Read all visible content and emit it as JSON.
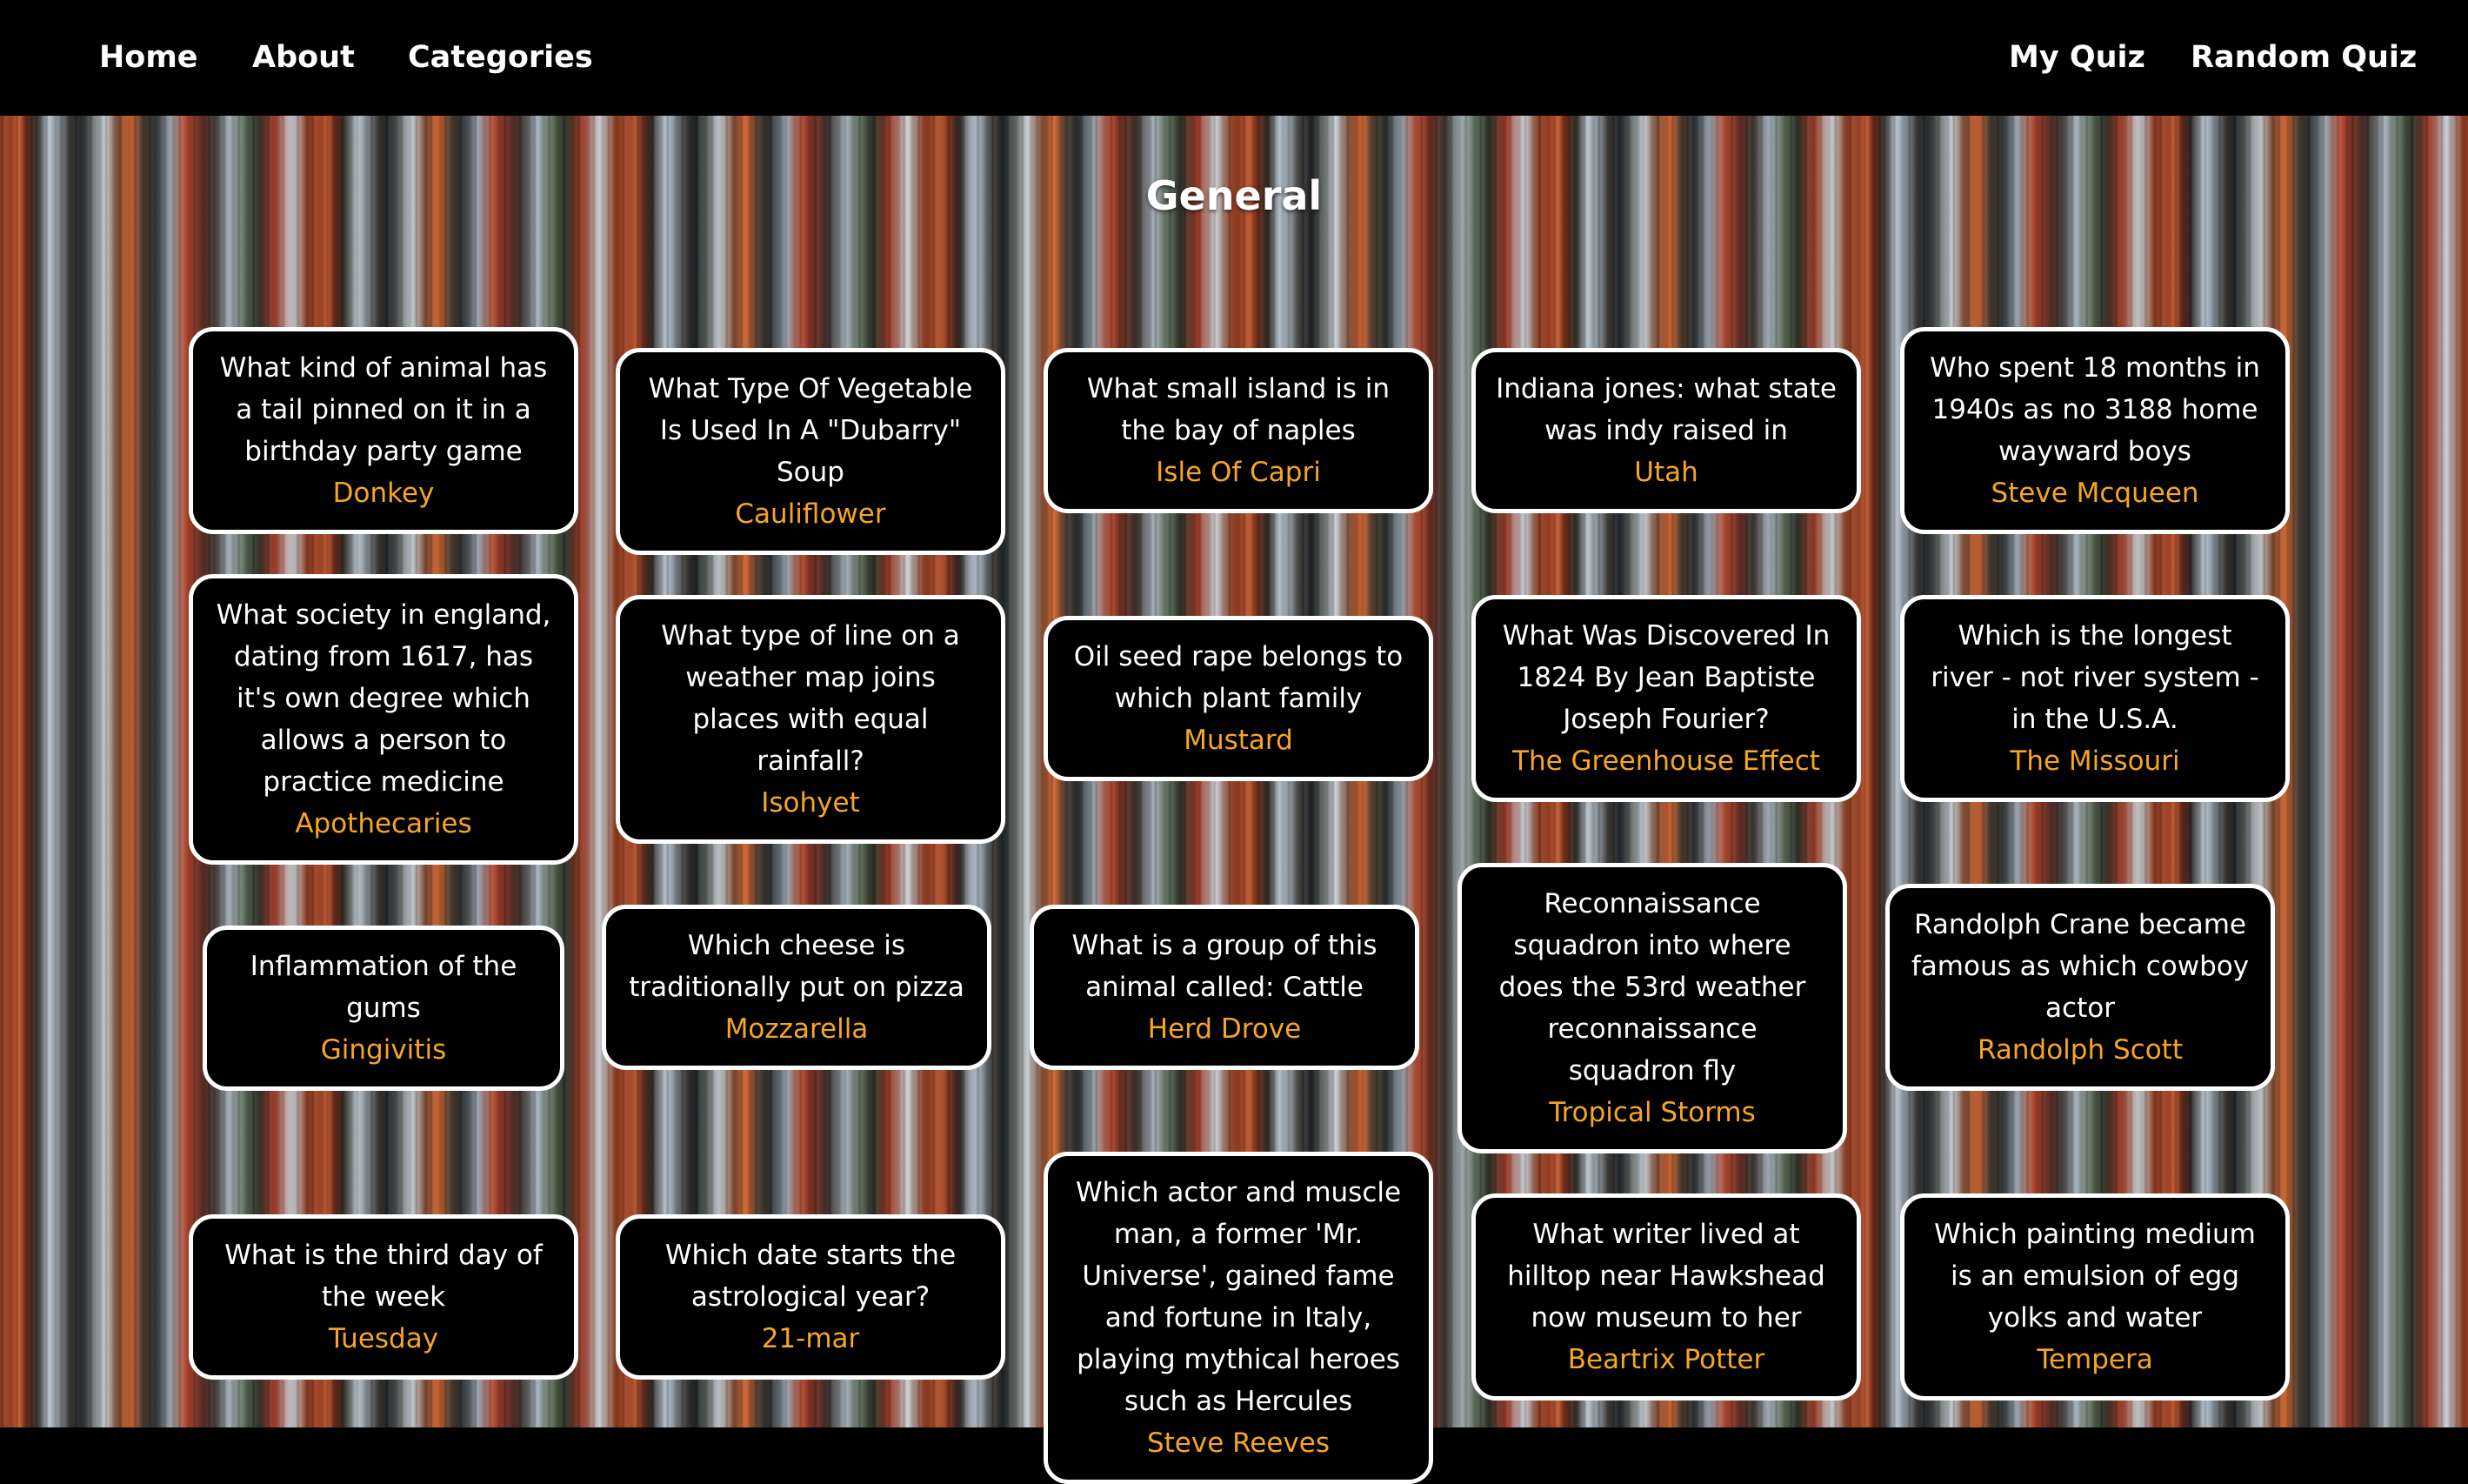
{
  "nav": {
    "home": "Home",
    "about": "About",
    "categories": "Categories",
    "my_quiz": "My Quiz",
    "random_quiz": "Random Quiz"
  },
  "page_title": "General",
  "colors": {
    "answer": "#f5a623",
    "card_bg": "#000000",
    "card_border": "#ffffff"
  },
  "cards": [
    {
      "q": "What kind of animal has a tail pinned on it in a birthday party game",
      "a": "Donkey"
    },
    {
      "q": "What Type Of Vegetable Is Used In A \"Dubarry\" Soup",
      "a": "Cauliflower"
    },
    {
      "q": "What small island is in the bay of naples",
      "a": "Isle Of Capri"
    },
    {
      "q": "Indiana jones: what state was indy raised in",
      "a": "Utah"
    },
    {
      "q": "Who spent 18 months in 1940s as no 3188 home wayward boys",
      "a": "Steve Mcqueen"
    },
    {
      "q": "What society in england, dating from 1617, has it's own degree which allows a person to practice medicine",
      "a": "Apothecaries"
    },
    {
      "q": "What type of line on a weather map joins places with equal rainfall?",
      "a": "Isohyet"
    },
    {
      "q": "Oil seed rape belongs to which plant family",
      "a": "Mustard"
    },
    {
      "q": "What Was Discovered In 1824 By Jean Baptiste Joseph Fourier?",
      "a": "The Greenhouse Effect"
    },
    {
      "q": "Which is the longest river - not river system - in the U.S.A.",
      "a": "The Missouri"
    },
    {
      "q": "Inflammation of the gums",
      "a": "Gingivitis"
    },
    {
      "q": "Which cheese is traditionally put on pizza",
      "a": "Mozzarella"
    },
    {
      "q": "What is a group of this animal called: Cattle",
      "a": "Herd Drove"
    },
    {
      "q": "Reconnaissance squadron into where does the 53rd weather reconnaissance squadron fly",
      "a": "Tropical Storms"
    },
    {
      "q": "Randolph Crane became famous as which cowboy actor",
      "a": "Randolph Scott"
    },
    {
      "q": "What is the third day of the week",
      "a": "Tuesday"
    },
    {
      "q": "Which date starts the astrological year?",
      "a": "21-mar"
    },
    {
      "q": "Which actor and muscle man, a former 'Mr. Universe', gained fame and fortune in Italy, playing mythical heroes such as Hercules",
      "a": "Steve Reeves"
    },
    {
      "q": "What writer lived at hilltop near Hawkshead now museum to her",
      "a": "Beartrix Potter"
    },
    {
      "q": "Which painting medium is an emulsion of egg yolks and water",
      "a": "Tempera"
    }
  ]
}
